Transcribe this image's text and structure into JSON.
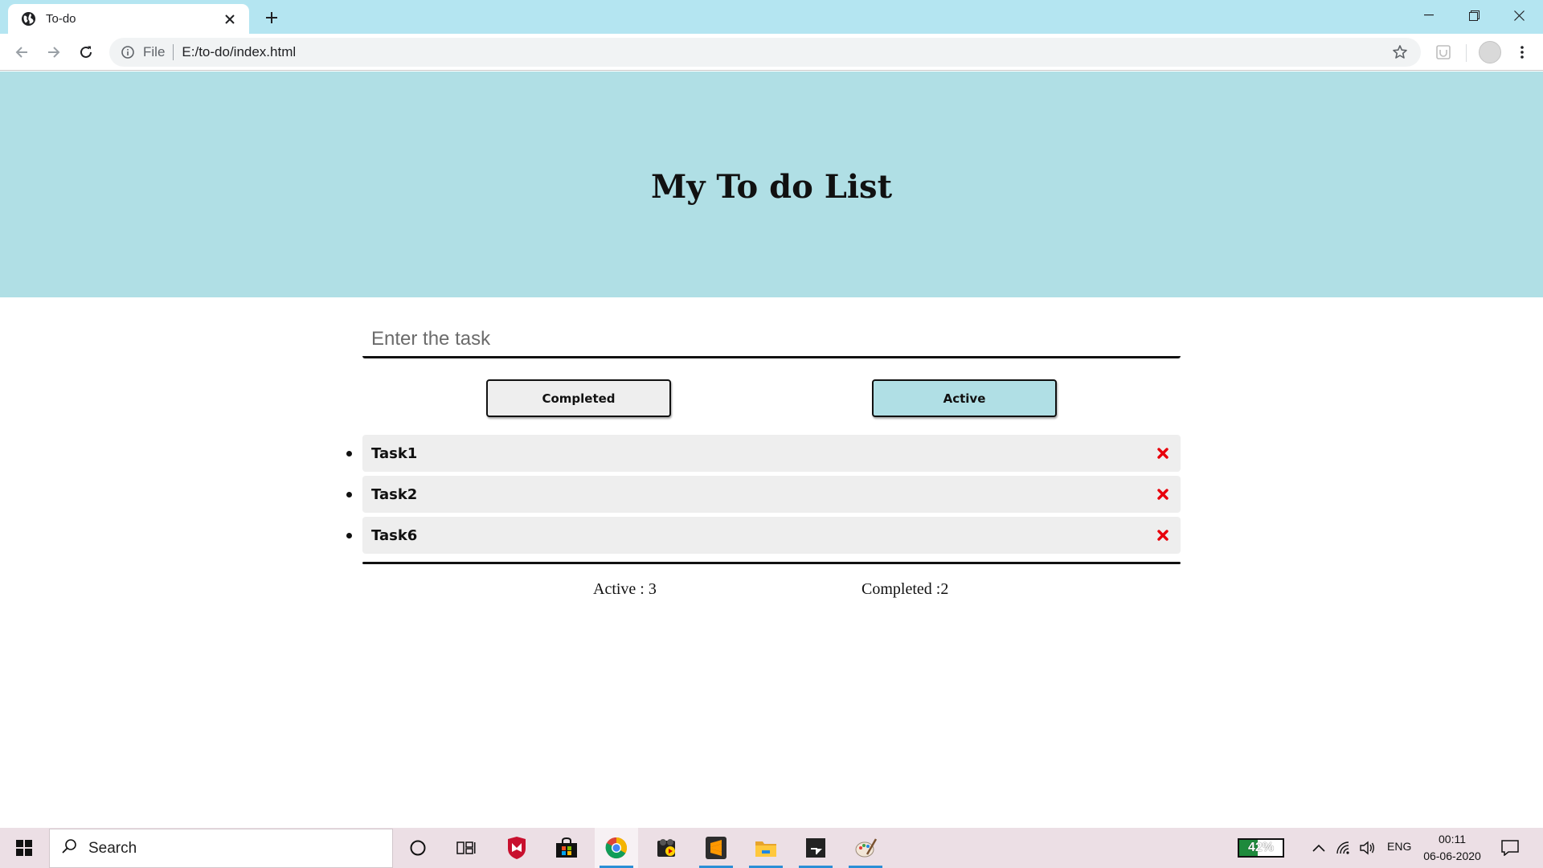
{
  "browser": {
    "tab_title": "To-do",
    "scheme_label": "File",
    "url": "E:/to-do/index.html"
  },
  "app": {
    "title": "My To do List",
    "input_placeholder": "Enter the task",
    "filters": {
      "completed_label": "Completed",
      "active_label": "Active"
    },
    "tasks": [
      {
        "label": "Task1"
      },
      {
        "label": "Task2"
      },
      {
        "label": "Task6"
      }
    ],
    "stats": {
      "active_text": "Active : 3",
      "completed_text": "Completed :2"
    }
  },
  "taskbar": {
    "search_text": "Search",
    "battery_text": "42%",
    "battery_level": 0.42,
    "language": "ENG",
    "time": "00:11",
    "date": "06-06-2020"
  },
  "colors": {
    "header_bg": "#b0dfe5",
    "tabstrip_bg": "#b4e5f1",
    "active_button_bg": "#b0dfe5",
    "task_bg": "#eeeeee",
    "delete_icon": "#e8000b"
  }
}
